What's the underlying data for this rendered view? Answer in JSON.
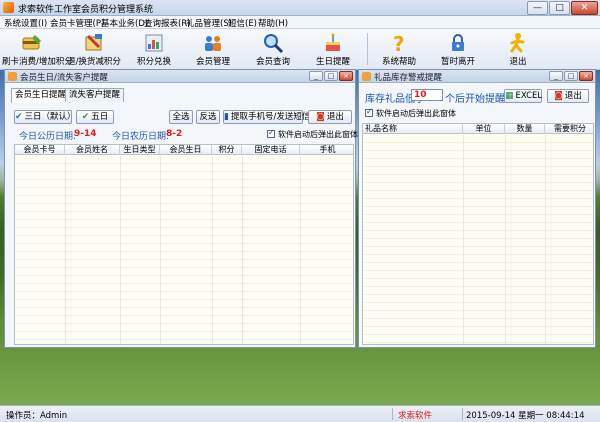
{
  "window": {
    "title": "求索软件工作室会员积分管理系统",
    "min": "—",
    "max": "□",
    "close": "✕"
  },
  "menu": [
    "系统设置(I)",
    "会员卡管理(P)",
    "基本业务(D)",
    "查询报表(R)",
    "礼品管理(S)",
    "短信(E)",
    "帮助(H)"
  ],
  "toolbar": [
    {
      "label": "刷卡消费/增加积分",
      "icon": "card-swipe-icon"
    },
    {
      "label": "退/换货减积分",
      "icon": "return-goods-icon"
    },
    {
      "label": "积分兑换",
      "icon": "points-exchange-icon"
    },
    {
      "label": "会员管理",
      "icon": "members-icon"
    },
    {
      "label": "会员查询",
      "icon": "search-icon"
    },
    {
      "label": "生日提醒",
      "icon": "birthday-icon"
    },
    {
      "label": "系统帮助",
      "icon": "help-icon"
    },
    {
      "label": "暂时离开",
      "icon": "lock-icon"
    },
    {
      "label": "退出",
      "icon": "exit-icon"
    }
  ],
  "left": {
    "title": "会员生日/流失客户提醒",
    "tabs": [
      "会员生日提醒",
      "流失客户提醒"
    ],
    "buttons": {
      "three_days": "三日（默认）",
      "five_days": "五日",
      "select_all": "全选",
      "invert": "反选",
      "extract": "提取手机号/发送短信",
      "exit": "退出"
    },
    "solar_label": "今日公历日期:",
    "solar_value": "9-14",
    "lunar_label": "今日农历日期:",
    "lunar_value": "8-2",
    "auto_popup": "软件启动后弹出此窗体",
    "columns": [
      "会员卡号",
      "会员姓名",
      "生日类型",
      "会员生日",
      "积分",
      "固定电话",
      "手机"
    ]
  },
  "right": {
    "title": "礼品库存警戒提醒",
    "low_stock_label": "库存礼品低于",
    "low_stock_value": "10",
    "low_stock_suffix": "个后开始提醒",
    "excel": "EXCEL",
    "exit": "退出",
    "auto_popup": "软件启动后弹出此窗体",
    "columns": [
      "礼品名称",
      "单位",
      "数量",
      "需要积分"
    ]
  },
  "status": {
    "operator": "操作员：Admin",
    "company": "求索软件",
    "datetime": "2015-09-14 星期一 08:44:14"
  },
  "colors": {
    "accent_red": "#e01b1b",
    "accent_blue": "#1b57b7"
  }
}
